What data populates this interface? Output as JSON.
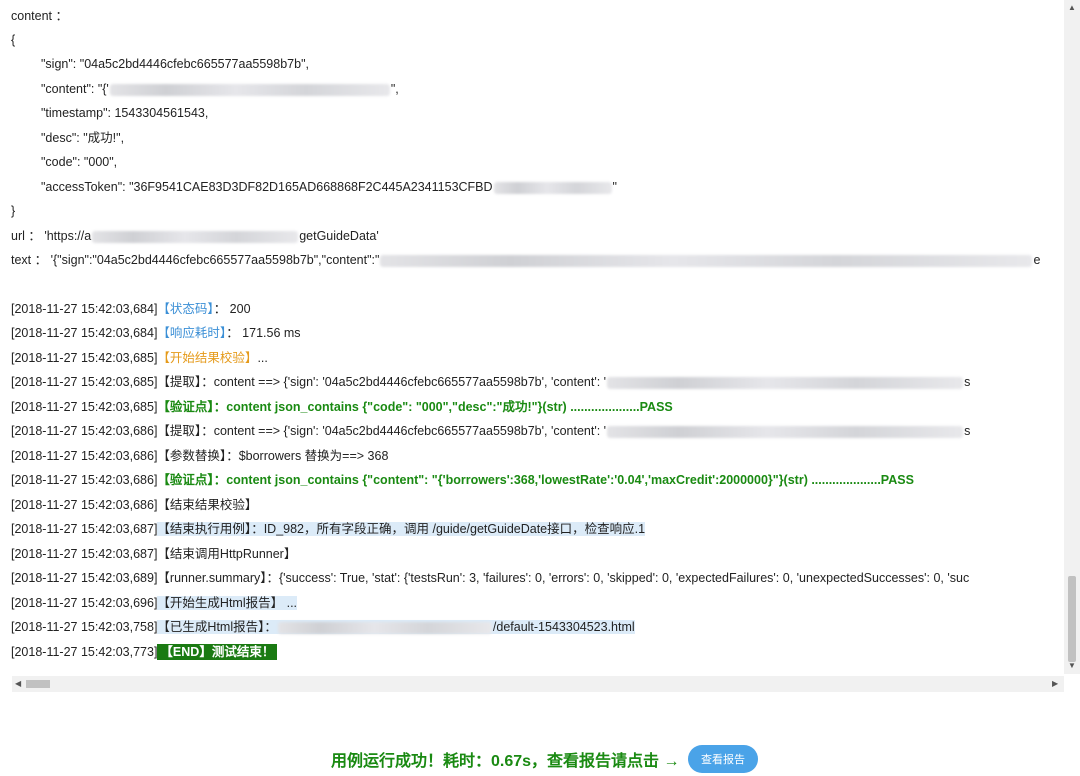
{
  "log": {
    "content_header": "content ：",
    "brace_open": "{",
    "sign_line": "\"sign\": \"04a5c2bd4446cfebc665577aa5598b7b\",",
    "content_line_prefix": "\"content\": \"{'",
    "content_line_suffix": "\",",
    "timestamp_line": "\"timestamp\": 1543304561543,",
    "desc_line": "\"desc\": \"成功!\",",
    "code_line": "\"code\": \"000\",",
    "token_line_prefix": "\"accessToken\": \"36F9541CAE83D3DF82D165AD668868F2C445A2341153CFBD",
    "token_line_suffix": "\"",
    "brace_close": "}",
    "url_prefix": "url ： 'https://a",
    "url_suffix": "getGuideData'",
    "text_line": "text ： '{\"sign\":\"04a5c2bd4446cfebc665577aa5598b7b\",\"content\":\"",
    "text_tail": "e",
    "entries": [
      {
        "ts": "[2018-11-27  15:42:03,684]",
        "tag": "【状态码】",
        "body": "：  200"
      },
      {
        "ts": "[2018-11-27  15:42:03,684]",
        "tag": "【响应耗时】",
        "body": "：  171.56  ms"
      },
      {
        "ts": "[2018-11-27  15:42:03,685]",
        "tag": "【开始结果校验】",
        "body": "..."
      },
      {
        "ts": "[2018-11-27  15:42:03,685]",
        "tag": "【提取】",
        "body": "：content    ==>    {'sign':  '04a5c2bd4446cfebc665577aa5598b7b',  'content':  '",
        "tail": "s"
      },
      {
        "ts": "[2018-11-27  15:42:03,685]",
        "tag": "【验证点】",
        "body": "：content  json_contains  {\"code\": \"000\",\"desc\":\"成功!\"}(str)    ....................PASS"
      },
      {
        "ts": "[2018-11-27  15:42:03,686]",
        "tag": "【提取】",
        "body": "：content    ==>    {'sign':  '04a5c2bd4446cfebc665577aa5598b7b',  'content':  '",
        "tail": "s"
      },
      {
        "ts": "[2018-11-27  15:42:03,686]",
        "tag": "【参数替换】",
        "body": "：$borrowers  替换为==>  368"
      },
      {
        "ts": "[2018-11-27  15:42:03,686]",
        "tag": "【验证点】",
        "body": "：content  json_contains  {\"content\":  \"{'borrowers':368,'lowestRate':'0.04','maxCredit':2000000}\"}(str)    ....................PASS"
      },
      {
        "ts": "[2018-11-27  15:42:03,686]",
        "tag": "【结束结果校验】",
        "body": ""
      },
      {
        "ts": "[2018-11-27  15:42:03,687]",
        "tag": "【结束执行用例】",
        "body": "：ID_982，所有字段正确，调用  /guide/getGuideDate接口，检查响应.1"
      },
      {
        "ts": "[2018-11-27  15:42:03,687]",
        "tag": "【结束调用HttpRunner】",
        "body": ""
      },
      {
        "ts": "[2018-11-27  15:42:03,689]",
        "tag": "【runner.summary】",
        "body": "：{'success':  True,  'stat':  {'testsRun':  3,  'failures':  0,  'errors':  0,  'skipped':  0,  'expectedFailures':  0,  'unexpectedSuccesses':  0,  'suc"
      },
      {
        "ts": "[2018-11-27  15:42:03,696]",
        "tag": "【开始生成Html报告】",
        "body": "  ..."
      },
      {
        "ts": "[2018-11-27  15:42:03,758]",
        "tag": "【已生成Html报告】",
        "body": "：",
        "suffix": "/default-1543304523.html"
      },
      {
        "ts": "[2018-11-27  15:42:03,773]",
        "tag": "【END】测试结束！",
        "body": ""
      }
    ]
  },
  "footer": {
    "message": "用例运行成功！耗时：0.67s，查看报告请点击 →",
    "button_label": "查看报告"
  },
  "colors": {
    "tag_blue": "#3b8fd6",
    "tag_orange": "#e59a1a",
    "success_green": "#1a8a12",
    "highlight": "#dcebf8",
    "button_blue": "#4aa3e8"
  }
}
